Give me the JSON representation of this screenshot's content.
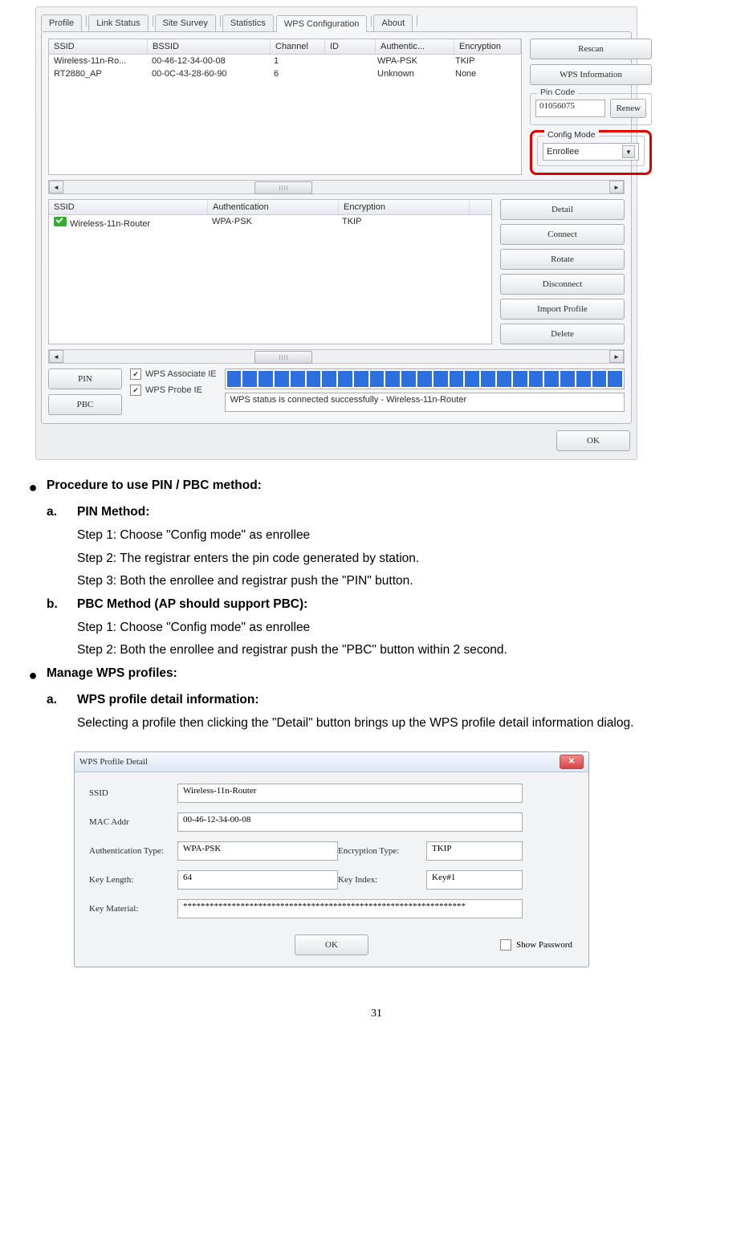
{
  "tabs": {
    "profile": "Profile",
    "link": "Link Status",
    "survey": "Site Survey",
    "stats": "Statistics",
    "wps": "WPS Configuration",
    "about": "About"
  },
  "top_table": {
    "headers": {
      "ssid": "SSID",
      "bssid": "BSSID",
      "ch": "Channel",
      "id": "ID",
      "auth": "Authentic...",
      "enc": "Encryption"
    },
    "rows": [
      {
        "ssid": "Wireless-11n-Ro...",
        "bssid": "00-46-12-34-00-08",
        "ch": "1",
        "id": "",
        "auth": "WPA-PSK",
        "enc": "TKIP"
      },
      {
        "ssid": "RT2880_AP",
        "bssid": "00-0C-43-28-60-90",
        "ch": "6",
        "id": "",
        "auth": "Unknown",
        "enc": "None"
      }
    ]
  },
  "side1": {
    "rescan": "Rescan",
    "wpsinfo": "WPS Information",
    "pin_legend": "Pin Code",
    "pin_value": "01056075",
    "renew": "Renew",
    "cfg_legend": "Config Mode",
    "cfg_value": "Enrollee"
  },
  "table2": {
    "headers": {
      "ssid": "SSID",
      "auth": "Authentication",
      "enc": "Encryption"
    },
    "row": {
      "ssid": "Wireless-11n-Router",
      "auth": "WPA-PSK",
      "enc": "TKIP"
    }
  },
  "side2": {
    "detail": "Detail",
    "connect": "Connect",
    "rotate": "Rotate",
    "disconnect": "Disconnect",
    "import": "Import Profile",
    "delete": "Delete"
  },
  "bottom": {
    "pin": "PIN",
    "pbc": "PBC",
    "assoc": "WPS Associate IE",
    "probe": "WPS Probe IE",
    "status": "WPS status is connected successfully - Wireless-11n-Router",
    "ok": "OK"
  },
  "doc": {
    "b1": "Procedure to use PIN / PBC method:",
    "a": "a.",
    "pin_h": "PIN Method:",
    "a1": "Step 1: Choose \"Config mode\" as enrollee",
    "a2": "Step 2: The registrar enters the pin code generated by station.",
    "a3": "Step 3: Both the enrollee and registrar push the \"PIN\" button.",
    "b": "b.",
    "pbc_h": "PBC Method (AP should support PBC):",
    "b1_": "Step 1: Choose \"Config mode\" as enrollee",
    "b2": "Step 2: Both the enrollee and registrar push the \"PBC\" button within 2 second.",
    "b2h": "Manage WPS profiles:",
    "c": "a.",
    "c_h": "WPS profile detail information:",
    "c_txt": "Selecting a profile then clicking the \"Detail\" button brings up the WPS profile detail information dialog."
  },
  "dlg": {
    "title": "WPS Profile Detail",
    "ssid_l": "SSID",
    "ssid_v": "Wireless-11n-Router",
    "mac_l": "MAC Addr",
    "mac_v": "00-46-12-34-00-08",
    "auth_l": "Authentication Type:",
    "auth_v": "WPA-PSK",
    "enc_l": "Encryption Type:",
    "enc_v": "TKIP",
    "klen_l": "Key Length:",
    "klen_v": "64",
    "kidx_l": "Key Index:",
    "kidx_v": "Key#1",
    "kmat_l": "Key Material:",
    "kmat_v": "****************************************************************",
    "ok": "OK",
    "show": "Show Password"
  },
  "page_number": "31"
}
